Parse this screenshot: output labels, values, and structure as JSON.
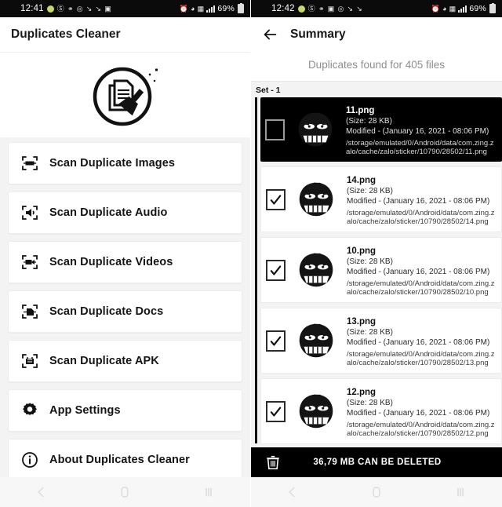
{
  "left": {
    "status_bar": {
      "clock": "12:41",
      "battery": "69%",
      "icons": [
        "dot-icon",
        "mute-icon",
        "location-icon",
        "nfc-icon",
        "download-icon",
        "download-icon",
        "image-icon"
      ],
      "right_icons": [
        "alarm-icon",
        "wifi-icon",
        "vpn-icon",
        "signal-icon"
      ]
    },
    "app_title": "Duplicates Cleaner",
    "logo": "documents-brush-logo",
    "menu": [
      {
        "label": "Scan Duplicate Images",
        "icon": "scan-image-icon"
      },
      {
        "label": "Scan Duplicate Audio",
        "icon": "scan-audio-icon"
      },
      {
        "label": "Scan Duplicate Videos",
        "icon": "scan-video-icon"
      },
      {
        "label": "Scan Duplicate Docs",
        "icon": "scan-doc-icon"
      },
      {
        "label": "Scan Duplicate APK",
        "icon": "scan-apk-icon"
      },
      {
        "label": "App Settings",
        "icon": "gear-icon"
      },
      {
        "label": "About Duplicates Cleaner",
        "icon": "info-icon"
      }
    ],
    "nav": [
      "back-icon",
      "home-icon",
      "recents-icon"
    ]
  },
  "right": {
    "status_bar": {
      "clock": "12:42",
      "battery": "69%"
    },
    "back_icon": "back-arrow-icon",
    "title": "Summary",
    "subtitle": "Duplicates found for 405 files",
    "set_label": "Set - 1",
    "items": [
      {
        "name": "11.png",
        "size": "(Size: 28 KB)",
        "modified": "Modified - (January 16, 2021 - 08:06 PM)",
        "path": "/storage/emulated/0/Android/data/com.zing.zalo/cache/zalo/sticker/10790/28502/11.png",
        "checked": false,
        "selected": true
      },
      {
        "name": "14.png",
        "size": "(Size: 28 KB)",
        "modified": "Modified - (January 16, 2021 - 08:06 PM)",
        "path": "/storage/emulated/0/Android/data/com.zing.zalo/cache/zalo/sticker/10790/28502/14.png",
        "checked": true,
        "selected": false
      },
      {
        "name": "10.png",
        "size": "(Size: 28 KB)",
        "modified": "Modified - (January 16, 2021 - 08:06 PM)",
        "path": "/storage/emulated/0/Android/data/com.zing.zalo/cache/zalo/sticker/10790/28502/10.png",
        "checked": true,
        "selected": false
      },
      {
        "name": "13.png",
        "size": "(Size: 28 KB)",
        "modified": "Modified - (January 16, 2021 - 08:06 PM)",
        "path": "/storage/emulated/0/Android/data/com.zing.zalo/cache/zalo/sticker/10790/28502/13.png",
        "checked": true,
        "selected": false
      },
      {
        "name": "12.png",
        "size": "(Size: 28 KB)",
        "modified": "Modified - (January 16, 2021 - 08:06 PM)",
        "path": "/storage/emulated/0/Android/data/com.zing.zalo/cache/zalo/sticker/10790/28502/12.png",
        "checked": true,
        "selected": false
      }
    ],
    "delete_bar": {
      "icon": "trash-icon",
      "label": "36,79 MB CAN BE DELETED"
    },
    "nav": [
      "back-icon",
      "home-icon",
      "recents-icon"
    ]
  },
  "colors": {
    "status_bar_bg": "#0b0b0b",
    "card_bg": "#ffffff",
    "page_bg": "#f3f3f3",
    "selected_row_bg": "#000000",
    "accent_text": "#8e8e8e"
  }
}
